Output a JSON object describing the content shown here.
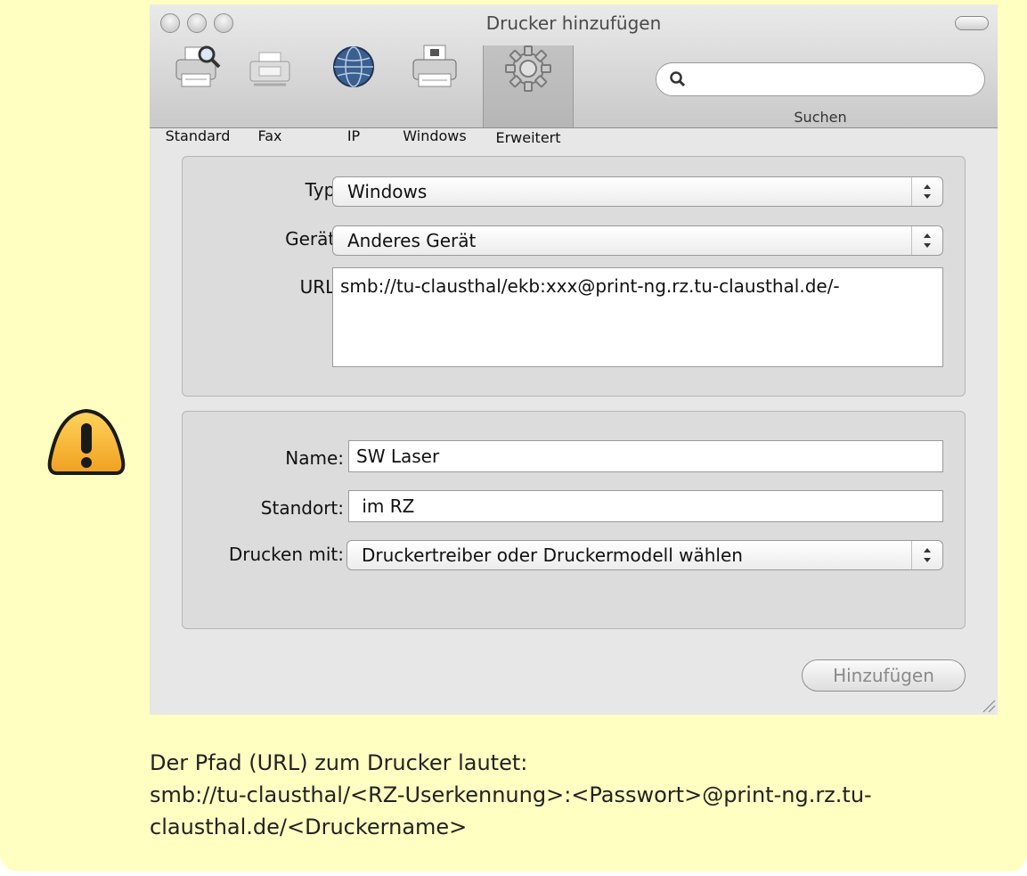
{
  "window": {
    "title": "Drucker hinzufügen"
  },
  "toolbar": {
    "items": [
      {
        "label": "Standard",
        "icon": "printer-magnifier-icon"
      },
      {
        "label": "Fax",
        "icon": "fax-icon"
      },
      {
        "label": "IP",
        "icon": "globe-icon"
      },
      {
        "label": "Windows",
        "icon": "windows-printer-icon"
      },
      {
        "label": "Erweitert",
        "icon": "gear-icon",
        "active": true
      }
    ],
    "search_label": "Suchen",
    "search_value": ""
  },
  "connection": {
    "type_label": "Typ:",
    "type_value": "Windows",
    "device_label": "Gerät:",
    "device_value": "Anderes Gerät",
    "url_label": "URL:",
    "url_value": "smb://tu-clausthal/ekb:xxx@print-ng.rz.tu-clausthal.de/-"
  },
  "printer": {
    "name_label": "Name:",
    "name_value": "SW Laser",
    "location_label": "Standort:",
    "location_value": " im RZ",
    "driver_label": "Drucken mit:",
    "driver_value": "Druckertreiber oder Druckermodell wählen"
  },
  "actions": {
    "add_label": "Hinzufügen"
  },
  "caption": {
    "line1": "Der Pfad (URL) zum Drucker lautet:",
    "line2": "smb://tu-clausthal/<RZ-Userkennung>:<Passwort>@print-ng.rz.tu-",
    "line3": "clausthal.de/<Druckername>"
  },
  "colors": {
    "note_background": "#ffffc2",
    "warning_fill": "#f5b731"
  }
}
